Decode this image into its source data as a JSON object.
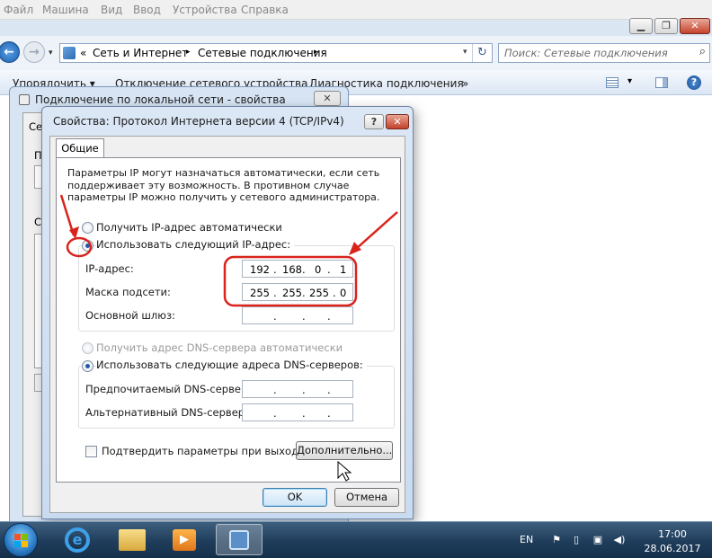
{
  "vm_menu": [
    "Файл",
    "Машина",
    "Вид",
    "Ввод",
    "Устройства",
    "Справка"
  ],
  "explorer": {
    "breadcrumb_prefix": "«",
    "breadcrumb": [
      "Сеть и Интернет",
      "Сетевые подключения"
    ],
    "search_placeholder": "Поиск: Сетевые подключения",
    "toolbar": [
      "Упорядочить ▾",
      "Отключение сетевого устройства",
      "Диагностика подключения",
      "»"
    ]
  },
  "back_dialog": {
    "title": "Подключение по локальной сети - свойства",
    "close": "✕",
    "fragments": [
      "Се",
      "П",
      "С"
    ]
  },
  "dialog": {
    "title": "Свойства: Протокол Интернета версии 4 (TCP/IPv4)",
    "help": "?",
    "close": "✕",
    "tab": "Общие",
    "description": "Параметры IP могут назначаться автоматически, если сеть поддерживает эту возможность. В противном случае параметры IP можно получить у сетевого администратора.",
    "radio_ip_auto": "Получить IP-адрес автоматически",
    "radio_ip_manual": "Использовать следующий IP-адрес:",
    "ip_label": "IP-адрес:",
    "ip_octets": [
      "192",
      "168",
      "0",
      "1"
    ],
    "mask_label": "Маска подсети:",
    "mask_octets": [
      "255",
      "255",
      "255",
      "0"
    ],
    "gateway_label": "Основной шлюз:",
    "gateway_octets": [
      "",
      "",
      "",
      ""
    ],
    "radio_dns_auto": "Получить адрес DNS-сервера автоматически",
    "radio_dns_manual": "Использовать следующие адреса DNS-серверов:",
    "dns_pref_label": "Предпочитаемый DNS-сервер:",
    "dns_alt_label": "Альтернативный DNS-сервер:",
    "validate_label": "Подтвердить параметры при выходе",
    "advanced_button": "Дополнительно...",
    "ok_button": "OK",
    "cancel_button": "Отмена"
  },
  "taskbar": {
    "lang": "EN",
    "time": "17:00",
    "date": "28.06.2017"
  },
  "colors": {
    "annotation_red": "#d9231c",
    "accent_blue": "#2358a8"
  }
}
